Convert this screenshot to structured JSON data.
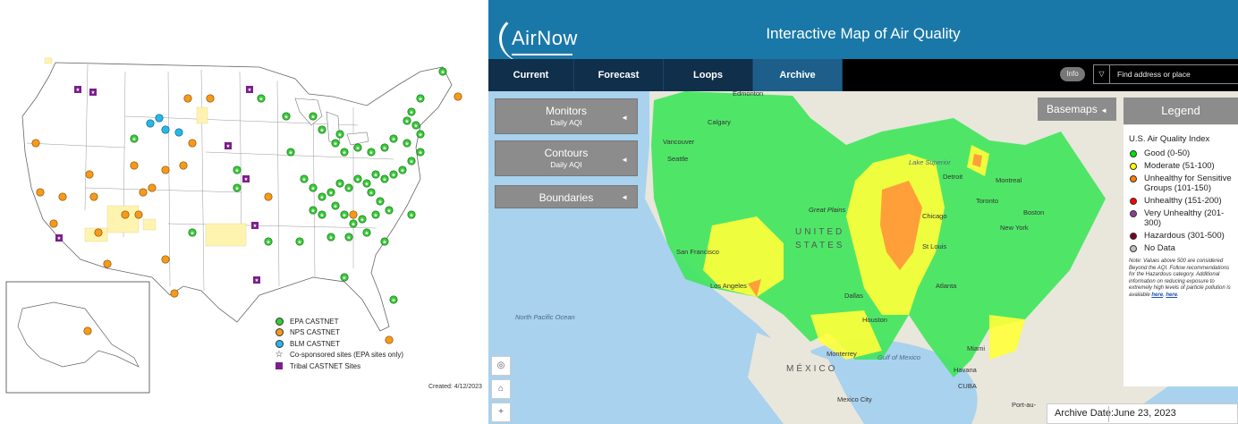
{
  "castnet": {
    "legend": [
      {
        "label": "EPA CASTNET",
        "color": "#33cc33",
        "shape": "dot"
      },
      {
        "label": "NPS CASTNET",
        "color": "#f59a1a",
        "shape": "dot"
      },
      {
        "label": "BLM CASTNET",
        "color": "#27b8ea",
        "shape": "dot"
      },
      {
        "label": "Co-sponsored sites (EPA sites only)",
        "color": "#ffffff",
        "shape": "star"
      },
      {
        "label": "Tribal CASTNET Sites",
        "color": "#7b1e8c",
        "shape": "square"
      }
    ],
    "created": "Created: 4/12/2023"
  },
  "airnow": {
    "logo_text": "AirNow",
    "title": "Interactive Map of Air Quality",
    "nav_tabs": [
      {
        "label": "Current",
        "active": false
      },
      {
        "label": "Forecast",
        "active": false
      },
      {
        "label": "Loops",
        "active": false
      },
      {
        "label": "Archive",
        "active": true
      }
    ],
    "info_label": "Info",
    "search_placeholder": "Find address or place",
    "side_buttons": [
      {
        "title": "Monitors",
        "subtitle": "Daily AQI"
      },
      {
        "title": "Contours",
        "subtitle": "Daily AQI"
      },
      {
        "title": "Boundaries",
        "subtitle": ""
      }
    ],
    "basemaps_label": "Basemaps",
    "legend_label": "Legend",
    "legend_title": "U.S. Air Quality Index",
    "aqi_categories": [
      {
        "label": "Good (0-50)",
        "color": "#00e400"
      },
      {
        "label": "Moderate (51-100)",
        "color": "#ffff00"
      },
      {
        "label": "Unhealthy for Sensitive Groups (101-150)",
        "color": "#ff7e00"
      },
      {
        "label": "Unhealthy (151-200)",
        "color": "#ff0000"
      },
      {
        "label": "Very Unhealthy (201-300)",
        "color": "#8f3f97"
      },
      {
        "label": "Hazardous (301-500)",
        "color": "#7e0023"
      },
      {
        "label": "No Data",
        "color": "#c0c0c0"
      }
    ],
    "legend_note": "Note: Values above 500 are considered Beyond the AQI. Follow recommendations for the Hazardous category. Additional information on reducing exposure to extremely high levels of particle pollution is available",
    "legend_note_links": [
      "here",
      "here"
    ],
    "map_labels": [
      "Edmonton",
      "Calgary",
      "Vancouver",
      "Seattle",
      "Great Plains",
      "UNITED",
      "STATES",
      "San Francisco",
      "Los Angeles",
      "Dallas",
      "Houston",
      "Monterrey",
      "MÉXICO",
      "Mexico City",
      "Chicago",
      "Detroit",
      "Toronto",
      "Montreal",
      "Boston",
      "New York",
      "St Louis",
      "Atlanta",
      "Miami",
      "Havana",
      "CUBA",
      "Port-au-",
      "Lake Superior",
      "Gulf of Mexico",
      "North Pacific Ocean"
    ],
    "archive_label": "Archive Date:",
    "archive_date": "June 23, 2023"
  }
}
